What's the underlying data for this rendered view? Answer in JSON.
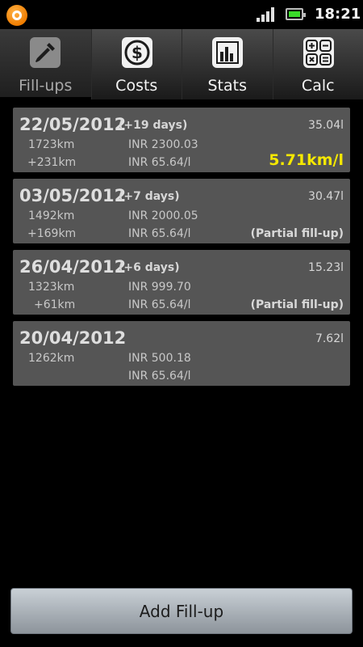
{
  "status_bar": {
    "time": "18:21"
  },
  "tabs": [
    {
      "label": "Fill-ups",
      "icon": "pipette-icon",
      "active": true
    },
    {
      "label": "Costs",
      "icon": "dollar-icon",
      "active": false
    },
    {
      "label": "Stats",
      "icon": "bar-chart-icon",
      "active": false
    },
    {
      "label": "Calc",
      "icon": "calculator-icon",
      "active": false
    }
  ],
  "fillups": [
    {
      "date": "22/05/2012",
      "days": "(+19 days)",
      "liters": "35.04l",
      "km": "1723km",
      "km_delta": "+231km",
      "cost": "INR 2300.03",
      "price": "INR 65.64/l",
      "efficiency": "5.71km/l",
      "note": ""
    },
    {
      "date": "03/05/2012",
      "days": "(+7 days)",
      "liters": "30.47l",
      "km": "1492km",
      "km_delta": "+169km",
      "cost": "INR 2000.05",
      "price": "INR 65.64/l",
      "efficiency": "",
      "note": "(Partial fill-up)"
    },
    {
      "date": "26/04/2012",
      "days": "(+6 days)",
      "liters": "15.23l",
      "km": "1323km",
      "km_delta": "+61km",
      "cost": "INR 999.70",
      "price": "INR 65.64/l",
      "efficiency": "",
      "note": "(Partial fill-up)"
    },
    {
      "date": "20/04/2012",
      "days": "",
      "liters": "7.62l",
      "km": "1262km",
      "km_delta": "",
      "cost": "INR 500.18",
      "price": "INR 65.64/l",
      "efficiency": "",
      "note": ""
    }
  ],
  "add_button": {
    "label": "Add Fill-up"
  },
  "colors": {
    "efficiency": "#f5e800",
    "card": "#555555",
    "app_badge": "#f07d00"
  }
}
